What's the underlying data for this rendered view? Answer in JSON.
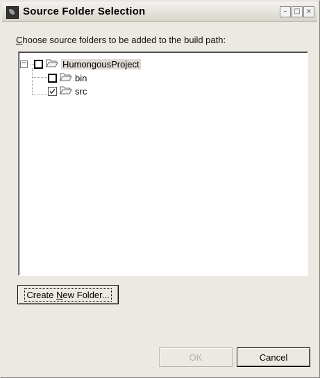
{
  "window": {
    "title": "Source Folder Selection",
    "buttons": {
      "minimize": "–",
      "maximize": "□",
      "close": "×"
    }
  },
  "prompt": {
    "mnemonic": "C",
    "rest": "hoose source folders to be added to the build path:"
  },
  "tree": {
    "root": {
      "label": "HumongousProject",
      "expanded": true,
      "checked": false,
      "icon": "folder-open-icon"
    },
    "children": [
      {
        "label": "bin",
        "checked": false,
        "icon": "folder-open-icon"
      },
      {
        "label": "src",
        "checked": true,
        "icon": "folder-open-icon"
      }
    ]
  },
  "buttons": {
    "create_prefix": "Create ",
    "create_mnemonic": "N",
    "create_suffix": "ew Folder...",
    "ok": "OK",
    "cancel": "Cancel"
  },
  "colors": {
    "dialog_bg": "#ece9e2",
    "tree_bg": "#ffffff",
    "selection_bg": "#dedbd5",
    "disabled_text": "#b4b1ab"
  }
}
